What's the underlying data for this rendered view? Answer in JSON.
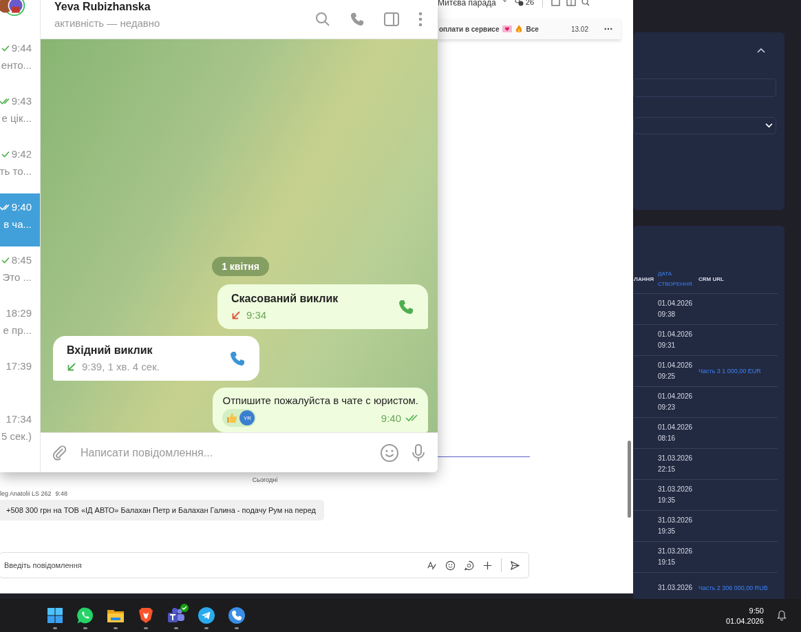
{
  "telegram": {
    "chat_list": [
      {
        "time": "9:44",
        "preview": "енто...",
        "read": false,
        "selected": false
      },
      {
        "time": "9:43",
        "preview": "е цік...",
        "read": true,
        "selected": false
      },
      {
        "time": "9:42",
        "preview": "ть то...",
        "read": false,
        "selected": false
      },
      {
        "time": "9:40",
        "preview": "в ча...",
        "read": true,
        "selected": true
      },
      {
        "time": "8:45",
        "preview": "Это ...",
        "read": false,
        "selected": false
      },
      {
        "time": "18:29",
        "preview": "е пр...",
        "selected": false
      },
      {
        "time": "17:39",
        "selected": false
      },
      {
        "time": "17:34",
        "preview": "5 сек.)",
        "selected": false
      }
    ],
    "header": {
      "name": "Yeva Rubizhanska",
      "status": "активність — недавно"
    },
    "date_chip": "1 квітня",
    "messages": [
      {
        "kind": "call",
        "incoming": false,
        "title": "Скасований виклик",
        "meta": "9:34",
        "missed": true
      },
      {
        "kind": "call",
        "incoming": true,
        "title": "Вхідний виклик",
        "meta": "9:39, 1 хв. 4 сек.",
        "missed": false
      },
      {
        "kind": "text",
        "incoming": false,
        "text": "Отпишите пожалуйста в чате с юристом.",
        "time": "9:40",
        "read": true,
        "reaction_avatar": "YR"
      }
    ],
    "composer": {
      "placeholder": "Написати повідомлення..."
    }
  },
  "back_window": {
    "title": "Митєва парада",
    "members": "26",
    "pinned": {
      "text": "оплати в сервисе",
      "tag": "Все",
      "date": "13.02"
    },
    "day_divider": "Сьогодні",
    "sender": "leg Anatolii LS 262",
    "sent_time": "9:48",
    "message": "+508 300 грн на ТОВ «ІД АВТО» Балахан Петр и Балахан Галина - подачу Рум на перед",
    "composer": {
      "placeholder": "Введіть повідомлення"
    }
  },
  "web_app": {
    "columns": [
      {
        "label": "ЛАННЯ",
        "sorted": false
      },
      {
        "label": "ДАТА СТВОРЕННЯ",
        "sorted": true
      },
      {
        "label": "CRM URL",
        "sorted": false
      }
    ],
    "rows": [
      {
        "date": "01.04.2026",
        "time": "09:38"
      },
      {
        "date": "01.04.2026",
        "time": "09:31"
      },
      {
        "date": "01.04.2026",
        "time": "09:25",
        "crm": "Часть 3 1 000,00 EUR"
      },
      {
        "date": "01.04.2026",
        "time": "09:23"
      },
      {
        "date": "01.04.2026",
        "time": "08:16"
      },
      {
        "date": "31.03.2026",
        "time": "22:15"
      },
      {
        "date": "31.03.2026",
        "time": "19:35"
      },
      {
        "date": "31.03.2026",
        "time": "19:35"
      },
      {
        "date": "31.03.2026",
        "time": "19:15"
      },
      {
        "date": "31.03.2026",
        "crm": "Часть 2 306 000,00 RUB"
      }
    ]
  },
  "taskbar": {
    "apps": [
      {
        "kind": "windows"
      },
      {
        "kind": "whatsapp"
      },
      {
        "kind": "files"
      },
      {
        "kind": "brave"
      },
      {
        "kind": "teams",
        "badge": true
      },
      {
        "kind": "telegram"
      },
      {
        "kind": "phone"
      }
    ],
    "clock": {
      "time": "9:50",
      "date": "01.04.2026"
    }
  }
}
